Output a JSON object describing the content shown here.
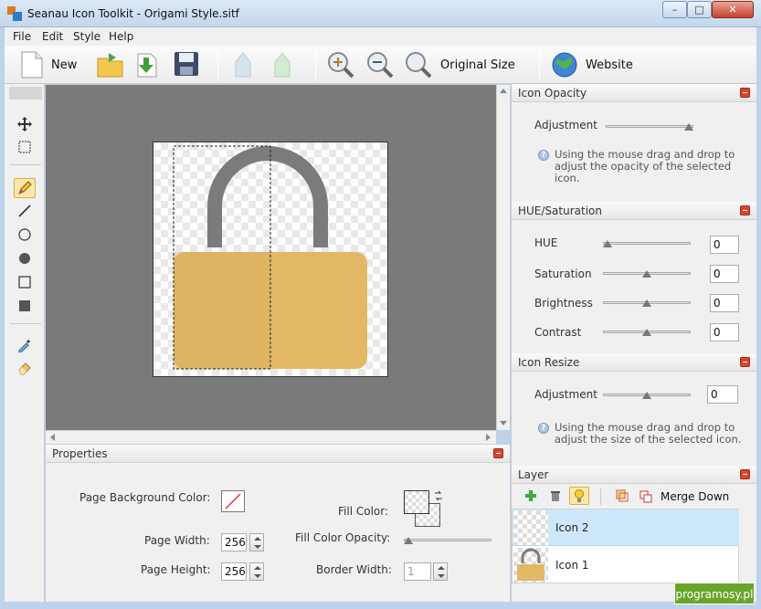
{
  "window": {
    "title": "Seanau Icon Toolkit - Origami Style.sitf",
    "min": "–",
    "max": "□",
    "close": "✕"
  },
  "menu": [
    "File",
    "Edit",
    "Style",
    "Help"
  ],
  "toolbar": {
    "new": "New",
    "original_size": "Original Size",
    "website": "Website"
  },
  "properties": {
    "title": "Properties",
    "page_bg_label": "Page Background Color:",
    "page_width_label": "Page Width:",
    "page_width": "256",
    "page_height_label": "Page Height:",
    "page_height": "256",
    "fill_color_label": "Fill Color:",
    "fill_opacity_label": "Fill Color Opacity:",
    "fill_opacity": 0.0,
    "border_width_label": "Border Width:",
    "border_width": "1"
  },
  "opacity": {
    "title": "Icon Opacity",
    "adjust_label": "Adjustment",
    "value": 1.0,
    "help": [
      "Using the mouse drag and drop to",
      "adjust the opacity of the selected",
      "icon."
    ]
  },
  "hue": {
    "title": "HUE/Saturation",
    "rows": [
      {
        "label": "HUE",
        "value": "0",
        "level": 0.0
      },
      {
        "label": "Saturation",
        "value": "0",
        "level": 0.5
      },
      {
        "label": "Brightness",
        "value": "0",
        "level": 0.5
      },
      {
        "label": "Contrast",
        "value": "0",
        "level": 0.5
      }
    ]
  },
  "resize": {
    "title": "Icon Resize",
    "adjust_label": "Adjustment",
    "value": "0",
    "level": 0.5,
    "help": [
      "Using the mouse drag and drop to",
      "adjust the size of the selected icon."
    ]
  },
  "layer": {
    "title": "Layer",
    "merge_down": "Merge Down",
    "items": [
      {
        "name": "Icon 2",
        "selected": true
      },
      {
        "name": "Icon 1",
        "selected": false
      }
    ]
  },
  "watermark": "programosy.pl",
  "colors": {
    "lock_body": "#e3b865",
    "lock_shackle": "#7b7b7b",
    "selected_layer": "#cde8fb"
  }
}
